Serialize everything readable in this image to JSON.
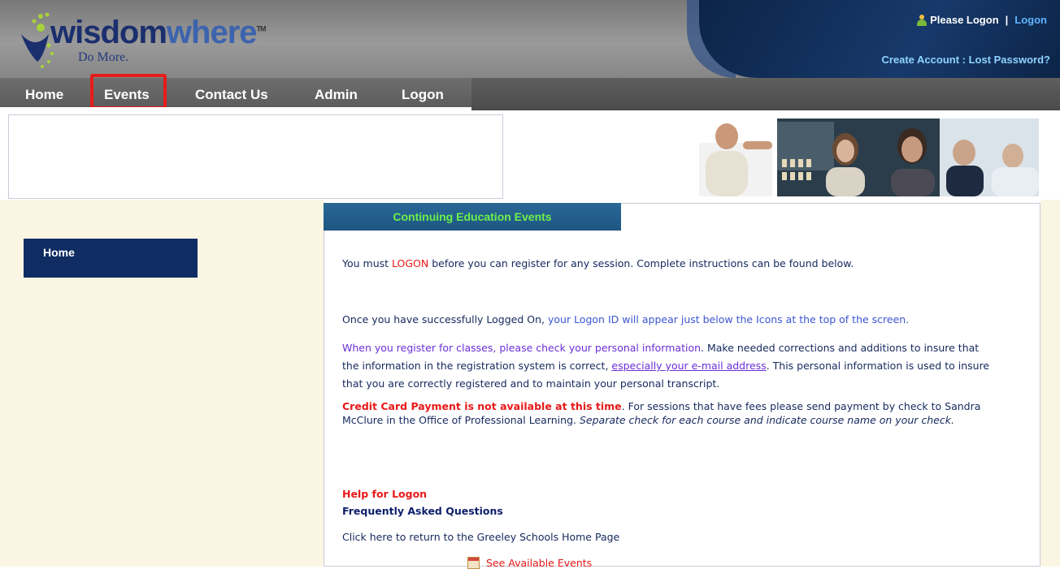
{
  "header": {
    "logo_brand_part1": "wisdom",
    "logo_brand_part2": "where",
    "logo_tm": "TM",
    "logo_tagline": "Do More.",
    "please_logon": "Please Logon",
    "separator": "|",
    "logon_link": "Logon",
    "create_account": "Create Account : Lost Password?"
  },
  "nav": {
    "items": [
      {
        "label": "Home"
      },
      {
        "label": "Events"
      },
      {
        "label": "Contact Us"
      },
      {
        "label": "Admin"
      },
      {
        "label": "Logon"
      }
    ],
    "highlighted": "Events"
  },
  "sidebar": {
    "home_label": "Home"
  },
  "main": {
    "tab_title": "Continuing Education Events",
    "p1_a": "You must ",
    "p1_logon": "LOGON",
    "p1_b": " before you can register for any session. Complete instructions can be found below.",
    "p2_a": "Once you have successfully Logged On, ",
    "p2_b": "your Logon ID will appear just below the Icons at the top of the screen.",
    "p3_a": "When you register for classes, please check your personal information",
    "p3_b": ". Make needed corrections and additions to insure that the information in the registration system is correct, ",
    "p3_link": "especially your e-mail address",
    "p3_c": ". This personal information is used to insure that you are correctly registered and to maintain your personal transcript.",
    "p4_red": "Credit Card Payment is not available at this time",
    "p4_a": ". For sessions that have fees please send payment by check to Sandra McClure in the Office of Professional Learning. ",
    "p4_italic": "Separate check for each course and indicate course name on your check.",
    "help_logon": "Help for Logon",
    "faq": "Frequently Asked Questions",
    "greeley": "Click here to return to the Greeley Schools Home Page",
    "see_events": "See Available Events"
  },
  "colors": {
    "accent_red": "#e81818",
    "nav_highlight": "#e81b1b",
    "sidebar_bg": "#fbf6e3",
    "tab_bg": "#1d5683",
    "tab_text": "#6cf04a",
    "header_panel": "#0c2447"
  },
  "icons": {
    "user": "user-icon",
    "calendar": "calendar-icon"
  }
}
